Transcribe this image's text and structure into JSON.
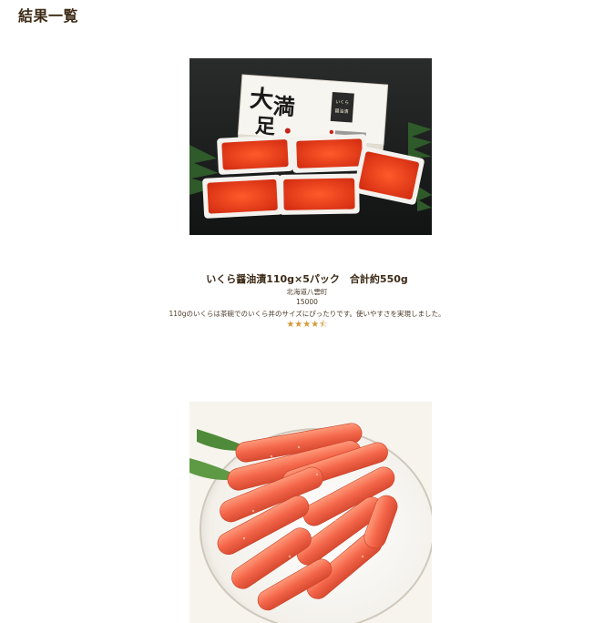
{
  "heading": "結果一覧",
  "products": [
    {
      "title": "いくら醤油漬110g×5パック　合計約550g",
      "region": "北海道八雲町",
      "price": "15000",
      "description": "110gのいくらは茶碗でのいくら丼のサイズにぴったりです。使いやすさを実現しました。",
      "rating_value": 4.5,
      "rating_max": 5,
      "image_label": "大満足",
      "image_icon": "ikura-box-icon"
    },
    {
      "image_icon": "mentaiko-plate-icon"
    }
  ],
  "colors": {
    "heading": "#3d2b16",
    "star": "#d49a3a",
    "ikura": "#e8401c"
  }
}
